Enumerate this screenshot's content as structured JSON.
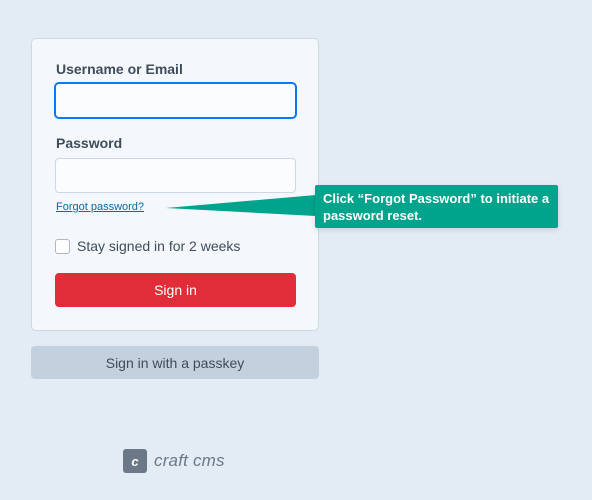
{
  "login": {
    "username_label": "Username or Email",
    "username_value": "",
    "password_label": "Password",
    "password_value": "",
    "forgot_link": "Forgot password?",
    "remember_label": "Stay signed in for 2 weeks",
    "remember_checked": false,
    "signin_button": "Sign in"
  },
  "passkey_button": "Sign in with a passkey",
  "tooltip": {
    "text": "Click “Forgot Password” to initiate a password reset."
  },
  "brand": {
    "mark": "c",
    "name": "craft cms"
  },
  "colors": {
    "background": "#e3ecf5",
    "signin_button": "#e12d39",
    "tooltip": "#00a38c",
    "focus_ring": "#0d78f2",
    "link": "#0b69a3"
  }
}
